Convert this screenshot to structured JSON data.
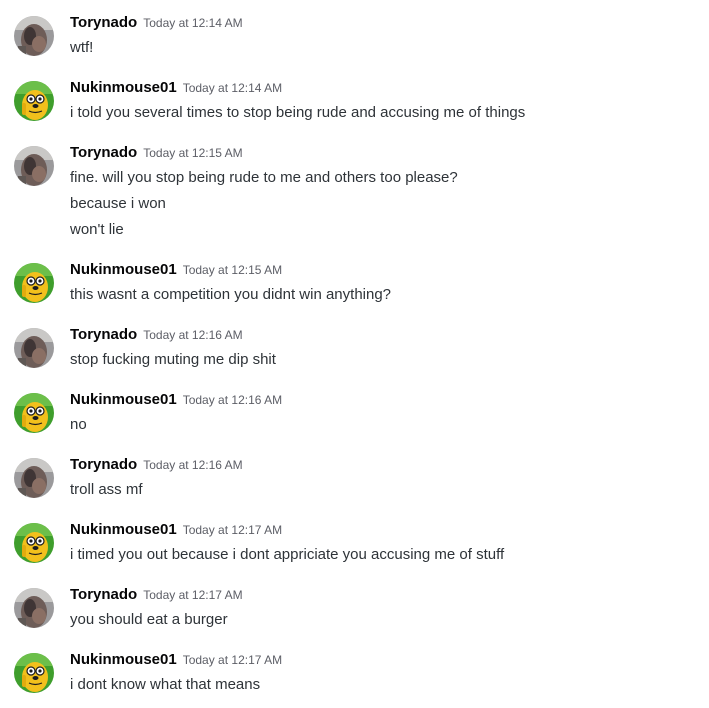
{
  "users": {
    "torynado": {
      "name": "Torynado",
      "avatar_icon": "rocky-wolf-avatar-icon"
    },
    "nukinmouse": {
      "name": "Nukinmouse01",
      "avatar_icon": "jake-the-dog-avatar-icon"
    }
  },
  "messages": [
    {
      "author": "Torynado",
      "timestamp": "Today at 12:14 AM",
      "lines": [
        "wtf!"
      ]
    },
    {
      "author": "Nukinmouse01",
      "timestamp": "Today at 12:14 AM",
      "lines": [
        "i told you several times to stop being rude and accusing me of things"
      ]
    },
    {
      "author": "Torynado",
      "timestamp": "Today at 12:15 AM",
      "lines": [
        "fine.  will you stop being rude to me and others too please?",
        "because i won",
        "won't lie"
      ]
    },
    {
      "author": "Nukinmouse01",
      "timestamp": "Today at 12:15 AM",
      "lines": [
        "this wasnt a competition you didnt win anything?"
      ]
    },
    {
      "author": "Torynado",
      "timestamp": "Today at 12:16 AM",
      "lines": [
        "stop fucking muting me dip shit"
      ]
    },
    {
      "author": "Nukinmouse01",
      "timestamp": "Today at 12:16 AM",
      "lines": [
        "no"
      ]
    },
    {
      "author": "Torynado",
      "timestamp": "Today at 12:16 AM",
      "lines": [
        "troll ass mf"
      ]
    },
    {
      "author": "Nukinmouse01",
      "timestamp": "Today at 12:17 AM",
      "lines": [
        "i timed you out because i dont appriciate you accusing me of stuff"
      ]
    },
    {
      "author": "Torynado",
      "timestamp": "Today at 12:17 AM",
      "lines": [
        "you  should eat a burger"
      ]
    },
    {
      "author": "Nukinmouse01",
      "timestamp": "Today at 12:17 AM",
      "lines": [
        "i dont know what that means"
      ]
    }
  ]
}
